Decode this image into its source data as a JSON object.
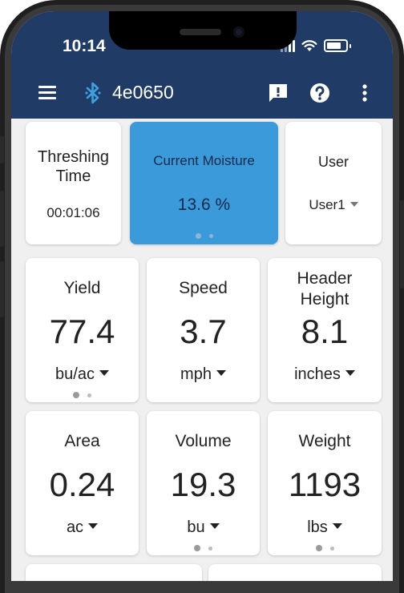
{
  "status_bar": {
    "time": "10:14"
  },
  "toolbar": {
    "device_name": "4e0650"
  },
  "top_cards": {
    "threshing": {
      "label_line1": "Threshing",
      "label_line2": "Time",
      "value": "00:01:06"
    },
    "moisture": {
      "label": "Current Moisture",
      "value": "13.6 %"
    },
    "user": {
      "label": "User",
      "value": "User1"
    }
  },
  "metrics": [
    {
      "label": "Yield",
      "value": "77.4",
      "unit": "bu/ac"
    },
    {
      "label": "Speed",
      "value": "3.7",
      "unit": "mph"
    },
    {
      "label_line1": "Header",
      "label_line2": "Height",
      "value": "8.1",
      "unit": "inches"
    },
    {
      "label": "Area",
      "value": "0.24",
      "unit": "ac"
    },
    {
      "label": "Volume",
      "value": "19.3",
      "unit": "bu"
    },
    {
      "label": "Weight",
      "value": "1193",
      "unit": "lbs"
    }
  ],
  "colors": {
    "appbar": "#1f3b66",
    "active_card": "#3b9ad9",
    "background": "#f0f0f0"
  }
}
